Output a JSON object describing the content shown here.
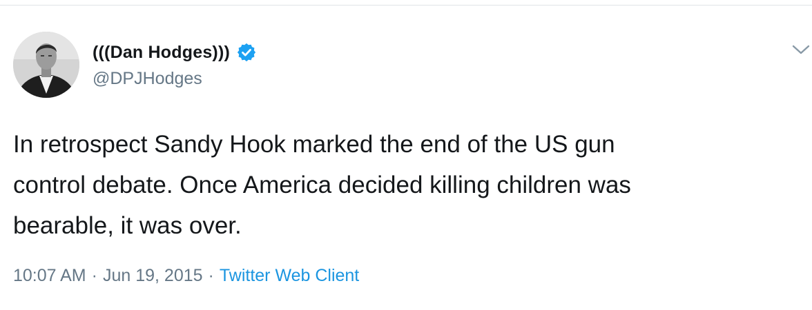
{
  "author": {
    "display_name": "(((Dan Hodges)))",
    "handle": "@DPJHodges",
    "verified": true,
    "verified_color": "#1da1f2",
    "avatar": "profile-photo"
  },
  "menu": {
    "icon": "chevron-down-icon"
  },
  "tweet": {
    "lines": [
      "In retrospect Sandy Hook marked the end of the US gun",
      "control debate. Once America decided killing children was",
      "bearable, it was over."
    ]
  },
  "meta": {
    "time": "10:07 AM",
    "separator": "·",
    "date": "Jun 19, 2015",
    "client": "Twitter Web Client",
    "client_color": "#1b95e0"
  }
}
